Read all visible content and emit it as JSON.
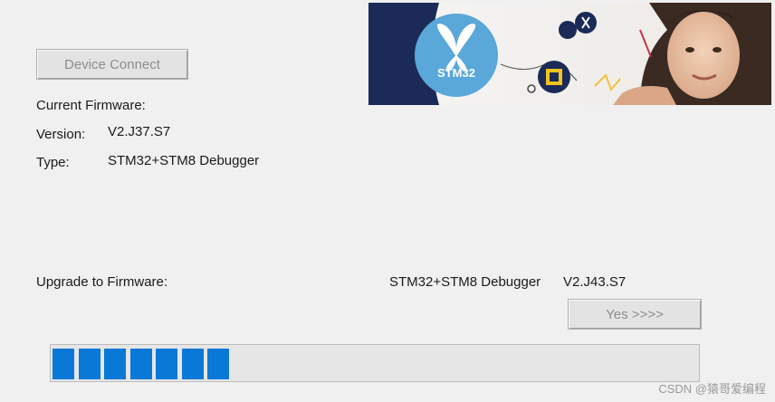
{
  "buttons": {
    "device_connect": "Device Connect",
    "yes": "Yes >>>>"
  },
  "current": {
    "heading": "Current Firmware:",
    "version_label": "Version:",
    "version_value": "V2.J37.S7",
    "type_label": "Type:",
    "type_value": "STM32+STM8 Debugger"
  },
  "upgrade": {
    "label": "Upgrade to Firmware:",
    "target_type": "STM32+STM8 Debugger",
    "target_version": "V2.J43.S7"
  },
  "banner": {
    "logo_text": "STM32"
  },
  "progress": {
    "segments_filled": 7,
    "color": "#0a78d7"
  },
  "watermark": "CSDN @猿哥爱编程",
  "colors": {
    "banner_navy": "#1b2a57",
    "logo_circle": "#5aa7da",
    "window_bg": "#f0f0f0"
  }
}
